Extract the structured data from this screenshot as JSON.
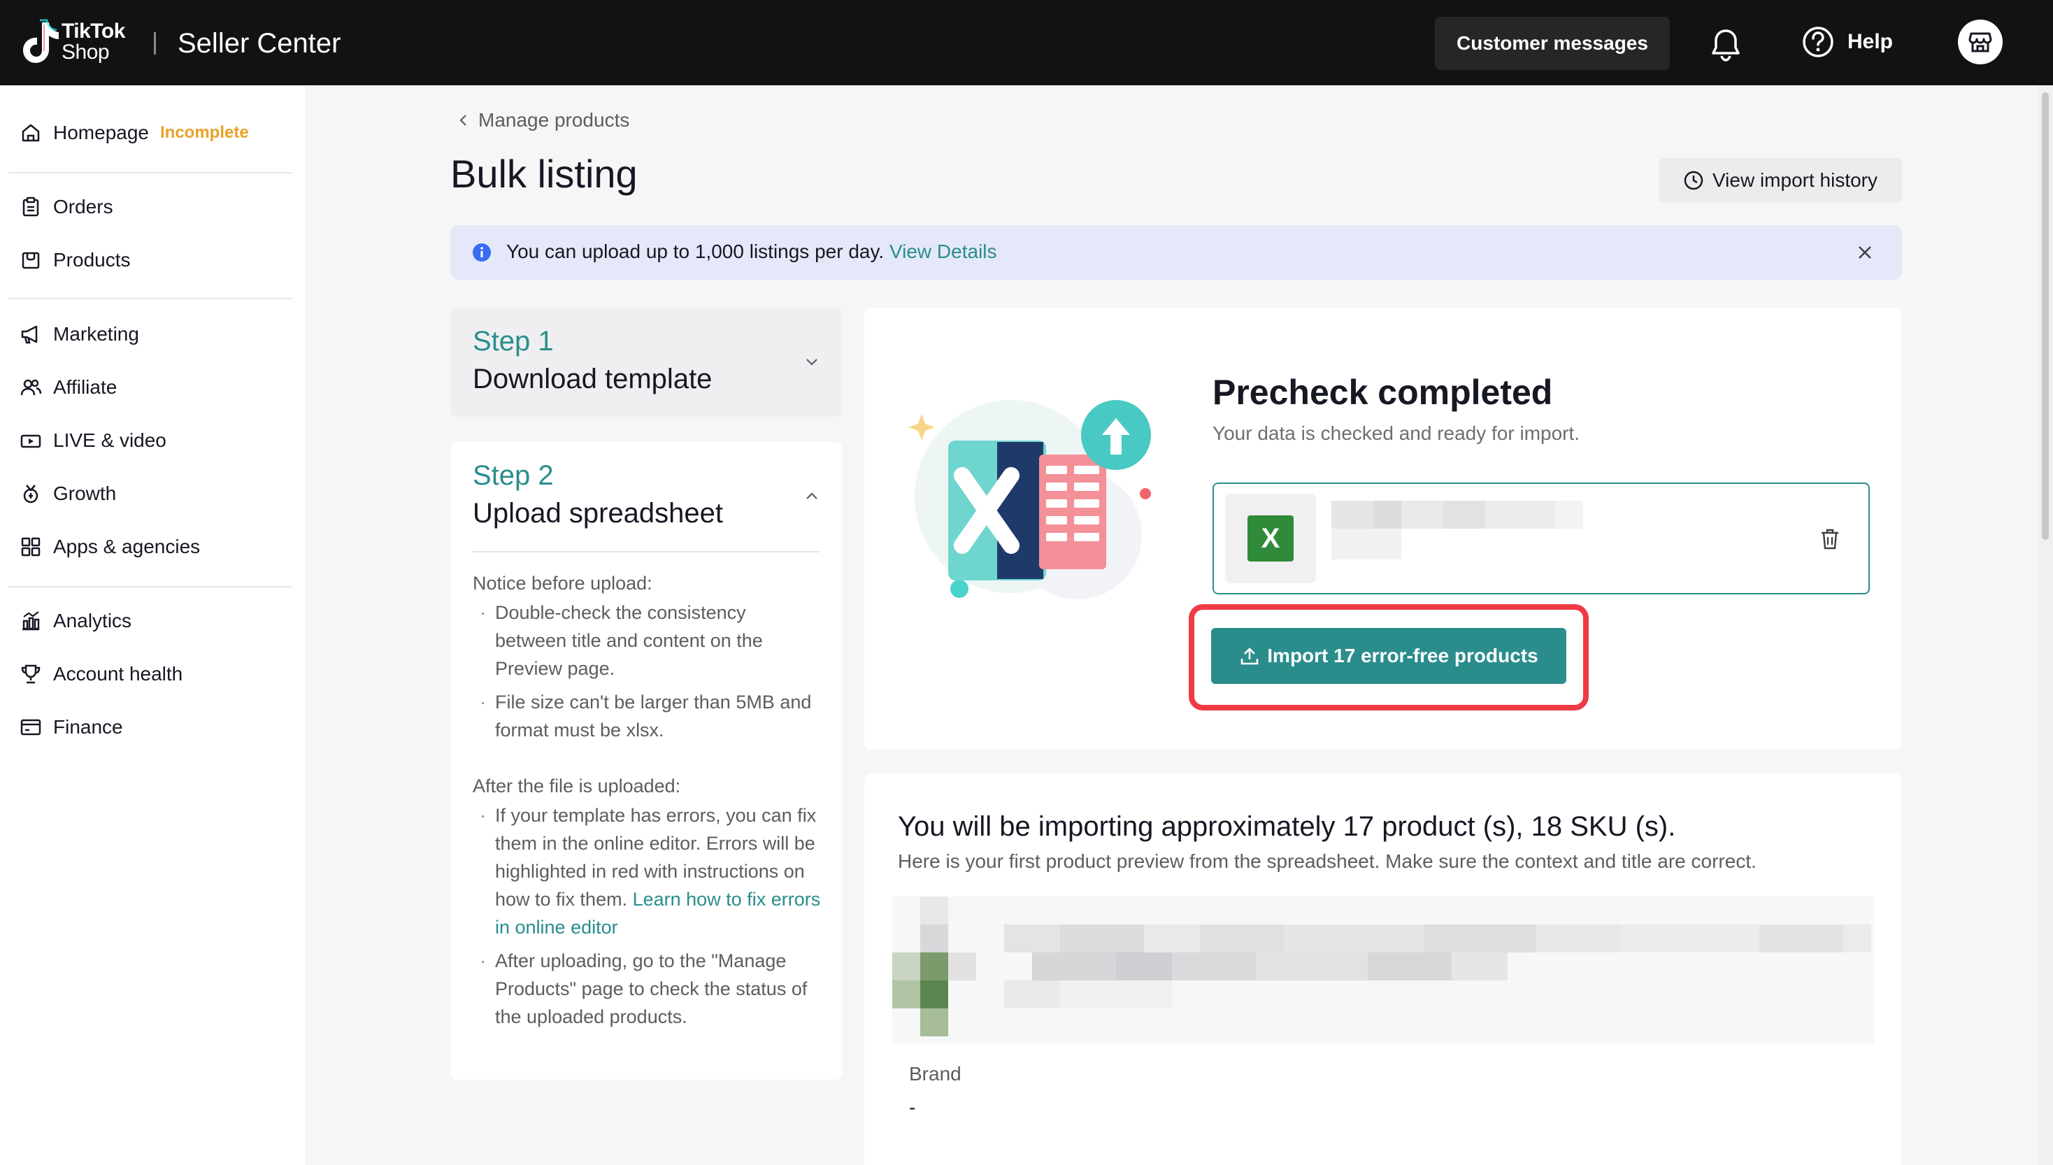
{
  "topbar": {
    "logo_line1": "TikTok",
    "logo_line2": "Shop",
    "title": "Seller Center",
    "customer_messages": "Customer messages",
    "help": "Help"
  },
  "sidebar": {
    "homepage": "Homepage",
    "homepage_badge": "Incomplete",
    "items": [
      {
        "label": "Orders",
        "icon": "clipboard-icon"
      },
      {
        "label": "Products",
        "icon": "box-icon"
      },
      {
        "label": "Marketing",
        "icon": "megaphone-icon"
      },
      {
        "label": "Affiliate",
        "icon": "people-icon"
      },
      {
        "label": "LIVE & video",
        "icon": "live-icon"
      },
      {
        "label": "Growth",
        "icon": "medal-icon"
      },
      {
        "label": "Apps & agencies",
        "icon": "apps-icon"
      },
      {
        "label": "Analytics",
        "icon": "chart-icon"
      },
      {
        "label": "Account health",
        "icon": "trophy-icon"
      },
      {
        "label": "Finance",
        "icon": "wallet-icon"
      }
    ]
  },
  "main": {
    "breadcrumb": "Manage products",
    "title": "Bulk listing",
    "history_button": "View import history",
    "banner": {
      "text": "You can upload up to 1,000 listings per day.",
      "link": "View Details"
    },
    "step1": {
      "num": "Step 1",
      "title": "Download template"
    },
    "step2": {
      "num": "Step 2",
      "title": "Upload spreadsheet",
      "notice_heading": "Notice before upload:",
      "notice_items": [
        "Double-check the consistency between title and content on the Preview page.",
        "File size can't be larger than 5MB and format must be xlsx."
      ],
      "after_heading": "After the file is uploaded:",
      "after_item1": "If your template has errors, you can fix them in the online editor. Errors will be highlighted in red with instructions on how to fix them.",
      "after_item1_link": "Learn how to fix errors in online editor",
      "after_item2": "After uploading, go to the \"Manage Products\" page to check the status of the uploaded products."
    },
    "precheck": {
      "title": "Precheck completed",
      "subtitle": "Your data is checked and ready for import.",
      "file_icon_letter": "X",
      "import_button": "Import 17 error-free products"
    },
    "preview": {
      "title": "You will be importing approximately 17 product (s), 18 SKU (s).",
      "subtitle": "Here is your first product preview from the spreadsheet. Make sure the context and title are correct.",
      "brand_label": "Brand",
      "brand_value": "-"
    }
  },
  "colors": {
    "accent": "#2a8d8c",
    "topbar": "#121212",
    "highlight": "#ef3b45",
    "badge": "#e8a22a"
  }
}
